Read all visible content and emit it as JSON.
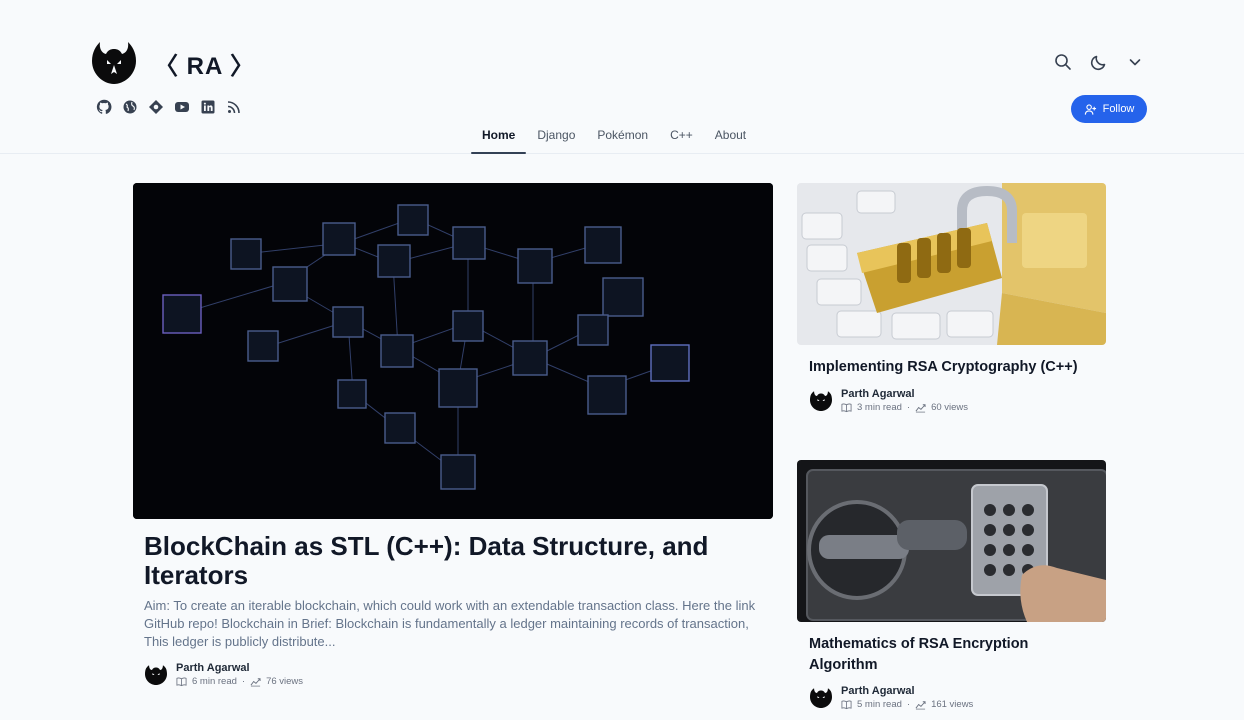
{
  "header": {
    "logo_text": "〈 RA 〉",
    "logo_icon": "raven-logo",
    "socials": [
      {
        "icon": "github-icon"
      },
      {
        "icon": "globe-icon"
      },
      {
        "icon": "hashnode-icon"
      },
      {
        "icon": "youtube-icon"
      },
      {
        "icon": "linkedin-icon"
      },
      {
        "icon": "rss-icon"
      }
    ],
    "tools": [
      {
        "icon": "search-icon"
      },
      {
        "icon": "moon-icon"
      },
      {
        "icon": "chevron-down-icon"
      }
    ],
    "follow_label": "Follow",
    "accent_color": "#2563eb"
  },
  "nav": {
    "items": [
      {
        "label": "Home",
        "active": true
      },
      {
        "label": "Django",
        "active": false
      },
      {
        "label": "Pokémon",
        "active": false
      },
      {
        "label": "C++",
        "active": false
      },
      {
        "label": "About",
        "active": false
      }
    ]
  },
  "featured": {
    "title": "BlockChain as STL (C++): Data Structure, and Iterators",
    "excerpt": "Aim: To create an iterable blockchain, which could work with an extendable transaction class. Here the link GitHub repo! Blockchain in Brief: Blockchain is fundamentally a ledger maintaining records of transaction, This ledger is publicly distribute...",
    "author": "Parth Agarwal",
    "read_time": "6 min read",
    "separator": "·",
    "views": "76 views"
  },
  "side_posts": [
    {
      "title": "Implementing RSA Cryptography (C++)",
      "author": "Parth Agarwal",
      "read_time": "3 min read",
      "separator": "·",
      "views": "60 views"
    },
    {
      "title": "Mathematics of RSA Encryption Algorithm",
      "author": "Parth Agarwal",
      "read_time": "5 min read",
      "separator": "·",
      "views": "161 views"
    }
  ]
}
